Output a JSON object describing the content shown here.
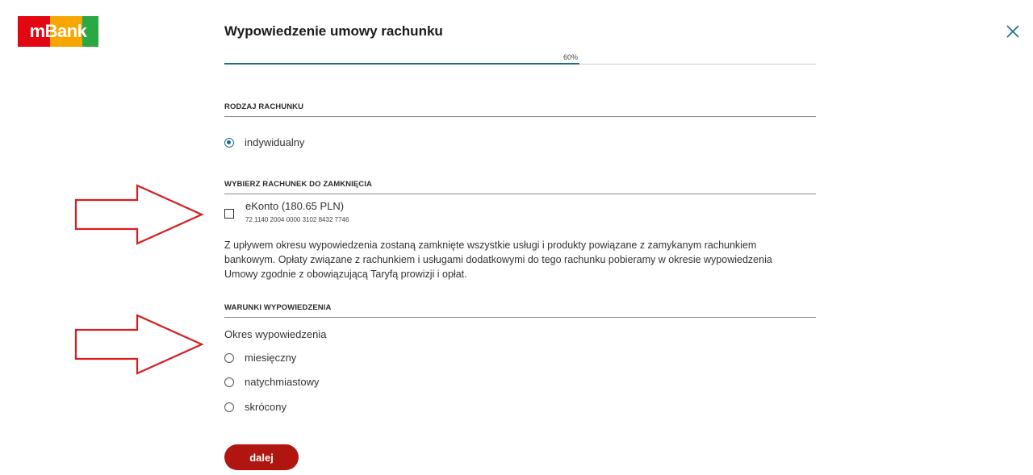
{
  "brand": {
    "logo_text": "mBank",
    "stripes": [
      "#e30613",
      "#e30613",
      "#f7a600",
      "#f7a600",
      "#2aa843"
    ]
  },
  "header": {
    "title": "Wypowiedzenie umowy rachunku"
  },
  "progress": {
    "value": 0.6,
    "label": "60%",
    "color": "#1e6b8f"
  },
  "account_type": {
    "section_title": "RODZAJ RACHUNKU",
    "options": [
      {
        "label": "indywidualny",
        "selected": true
      }
    ]
  },
  "account_select": {
    "section_title": "WYBIERZ RACHUNEK DO ZAMKNIĘCIA",
    "accounts": [
      {
        "name": "eKonto (180.65 PLN)",
        "number": "72 1140 2004 0000 3102 8432 7746",
        "checked": false
      }
    ],
    "info": "Z upływem okresu wypowiedzenia zostaną zamknięte wszystkie usługi i produkty powiązane z zamykanym rachunkiem bankowym. Opłaty związane z rachunkiem i usługami dodatkowymi do tego rachunku pobieramy w okresie wypowiedzenia Umowy zgodnie z obowiązującą Taryfą prowizji i opłat."
  },
  "termination": {
    "section_title": "WARUNKI WYPOWIEDZENIA",
    "field_label": "Okres wypowiedzenia",
    "options": [
      {
        "label": "miesięczny",
        "selected": false
      },
      {
        "label": "natychmiastowy",
        "selected": false
      },
      {
        "label": "skrócony",
        "selected": false
      }
    ]
  },
  "actions": {
    "next_label": "dalej",
    "button_color": "#b0150f"
  },
  "annotations": {
    "arrow_color": "#d42020"
  }
}
